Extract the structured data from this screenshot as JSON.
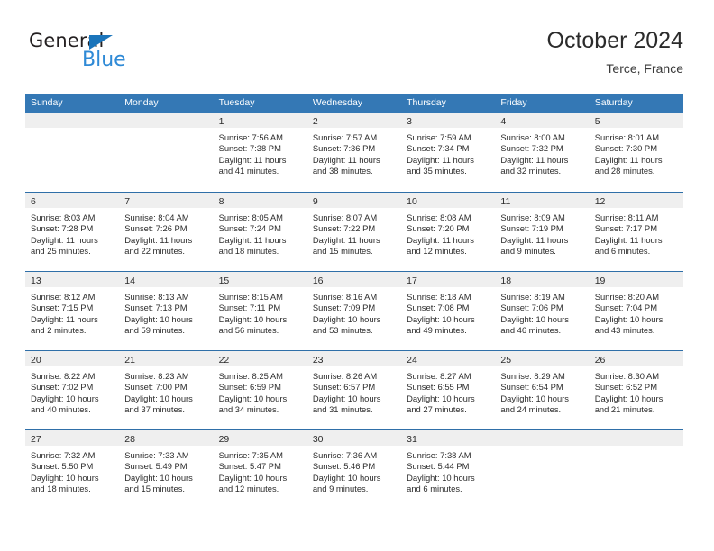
{
  "brand": {
    "word_one": "General",
    "word_two": "Blue",
    "triangle_icon": "brand-triangle-icon",
    "colors": {
      "dark": "#231f20",
      "blue": "#2f8ad6",
      "triangle": "#1b75bb"
    }
  },
  "header": {
    "title": "October 2024",
    "subtitle": "Terce, France"
  },
  "theme": {
    "header_blue": "#3478b5",
    "row_divider_blue": "#2f6fa8",
    "day_band_gray": "#efefef",
    "text": "#2b2b2b"
  },
  "weekdays": [
    "Sunday",
    "Monday",
    "Tuesday",
    "Wednesday",
    "Thursday",
    "Friday",
    "Saturday"
  ],
  "weeks": [
    [
      {
        "day": "",
        "lines": []
      },
      {
        "day": "",
        "lines": []
      },
      {
        "day": "1",
        "lines": [
          "Sunrise: 7:56 AM",
          "Sunset: 7:38 PM",
          "Daylight: 11 hours",
          "and 41 minutes."
        ]
      },
      {
        "day": "2",
        "lines": [
          "Sunrise: 7:57 AM",
          "Sunset: 7:36 PM",
          "Daylight: 11 hours",
          "and 38 minutes."
        ]
      },
      {
        "day": "3",
        "lines": [
          "Sunrise: 7:59 AM",
          "Sunset: 7:34 PM",
          "Daylight: 11 hours",
          "and 35 minutes."
        ]
      },
      {
        "day": "4",
        "lines": [
          "Sunrise: 8:00 AM",
          "Sunset: 7:32 PM",
          "Daylight: 11 hours",
          "and 32 minutes."
        ]
      },
      {
        "day": "5",
        "lines": [
          "Sunrise: 8:01 AM",
          "Sunset: 7:30 PM",
          "Daylight: 11 hours",
          "and 28 minutes."
        ]
      }
    ],
    [
      {
        "day": "6",
        "lines": [
          "Sunrise: 8:03 AM",
          "Sunset: 7:28 PM",
          "Daylight: 11 hours",
          "and 25 minutes."
        ]
      },
      {
        "day": "7",
        "lines": [
          "Sunrise: 8:04 AM",
          "Sunset: 7:26 PM",
          "Daylight: 11 hours",
          "and 22 minutes."
        ]
      },
      {
        "day": "8",
        "lines": [
          "Sunrise: 8:05 AM",
          "Sunset: 7:24 PM",
          "Daylight: 11 hours",
          "and 18 minutes."
        ]
      },
      {
        "day": "9",
        "lines": [
          "Sunrise: 8:07 AM",
          "Sunset: 7:22 PM",
          "Daylight: 11 hours",
          "and 15 minutes."
        ]
      },
      {
        "day": "10",
        "lines": [
          "Sunrise: 8:08 AM",
          "Sunset: 7:20 PM",
          "Daylight: 11 hours",
          "and 12 minutes."
        ]
      },
      {
        "day": "11",
        "lines": [
          "Sunrise: 8:09 AM",
          "Sunset: 7:19 PM",
          "Daylight: 11 hours",
          "and 9 minutes."
        ]
      },
      {
        "day": "12",
        "lines": [
          "Sunrise: 8:11 AM",
          "Sunset: 7:17 PM",
          "Daylight: 11 hours",
          "and 6 minutes."
        ]
      }
    ],
    [
      {
        "day": "13",
        "lines": [
          "Sunrise: 8:12 AM",
          "Sunset: 7:15 PM",
          "Daylight: 11 hours",
          "and 2 minutes."
        ]
      },
      {
        "day": "14",
        "lines": [
          "Sunrise: 8:13 AM",
          "Sunset: 7:13 PM",
          "Daylight: 10 hours",
          "and 59 minutes."
        ]
      },
      {
        "day": "15",
        "lines": [
          "Sunrise: 8:15 AM",
          "Sunset: 7:11 PM",
          "Daylight: 10 hours",
          "and 56 minutes."
        ]
      },
      {
        "day": "16",
        "lines": [
          "Sunrise: 8:16 AM",
          "Sunset: 7:09 PM",
          "Daylight: 10 hours",
          "and 53 minutes."
        ]
      },
      {
        "day": "17",
        "lines": [
          "Sunrise: 8:18 AM",
          "Sunset: 7:08 PM",
          "Daylight: 10 hours",
          "and 49 minutes."
        ]
      },
      {
        "day": "18",
        "lines": [
          "Sunrise: 8:19 AM",
          "Sunset: 7:06 PM",
          "Daylight: 10 hours",
          "and 46 minutes."
        ]
      },
      {
        "day": "19",
        "lines": [
          "Sunrise: 8:20 AM",
          "Sunset: 7:04 PM",
          "Daylight: 10 hours",
          "and 43 minutes."
        ]
      }
    ],
    [
      {
        "day": "20",
        "lines": [
          "Sunrise: 8:22 AM",
          "Sunset: 7:02 PM",
          "Daylight: 10 hours",
          "and 40 minutes."
        ]
      },
      {
        "day": "21",
        "lines": [
          "Sunrise: 8:23 AM",
          "Sunset: 7:00 PM",
          "Daylight: 10 hours",
          "and 37 minutes."
        ]
      },
      {
        "day": "22",
        "lines": [
          "Sunrise: 8:25 AM",
          "Sunset: 6:59 PM",
          "Daylight: 10 hours",
          "and 34 minutes."
        ]
      },
      {
        "day": "23",
        "lines": [
          "Sunrise: 8:26 AM",
          "Sunset: 6:57 PM",
          "Daylight: 10 hours",
          "and 31 minutes."
        ]
      },
      {
        "day": "24",
        "lines": [
          "Sunrise: 8:27 AM",
          "Sunset: 6:55 PM",
          "Daylight: 10 hours",
          "and 27 minutes."
        ]
      },
      {
        "day": "25",
        "lines": [
          "Sunrise: 8:29 AM",
          "Sunset: 6:54 PM",
          "Daylight: 10 hours",
          "and 24 minutes."
        ]
      },
      {
        "day": "26",
        "lines": [
          "Sunrise: 8:30 AM",
          "Sunset: 6:52 PM",
          "Daylight: 10 hours",
          "and 21 minutes."
        ]
      }
    ],
    [
      {
        "day": "27",
        "lines": [
          "Sunrise: 7:32 AM",
          "Sunset: 5:50 PM",
          "Daylight: 10 hours",
          "and 18 minutes."
        ]
      },
      {
        "day": "28",
        "lines": [
          "Sunrise: 7:33 AM",
          "Sunset: 5:49 PM",
          "Daylight: 10 hours",
          "and 15 minutes."
        ]
      },
      {
        "day": "29",
        "lines": [
          "Sunrise: 7:35 AM",
          "Sunset: 5:47 PM",
          "Daylight: 10 hours",
          "and 12 minutes."
        ]
      },
      {
        "day": "30",
        "lines": [
          "Sunrise: 7:36 AM",
          "Sunset: 5:46 PM",
          "Daylight: 10 hours",
          "and 9 minutes."
        ]
      },
      {
        "day": "31",
        "lines": [
          "Sunrise: 7:38 AM",
          "Sunset: 5:44 PM",
          "Daylight: 10 hours",
          "and 6 minutes."
        ]
      },
      {
        "day": "",
        "lines": []
      },
      {
        "day": "",
        "lines": []
      }
    ]
  ]
}
